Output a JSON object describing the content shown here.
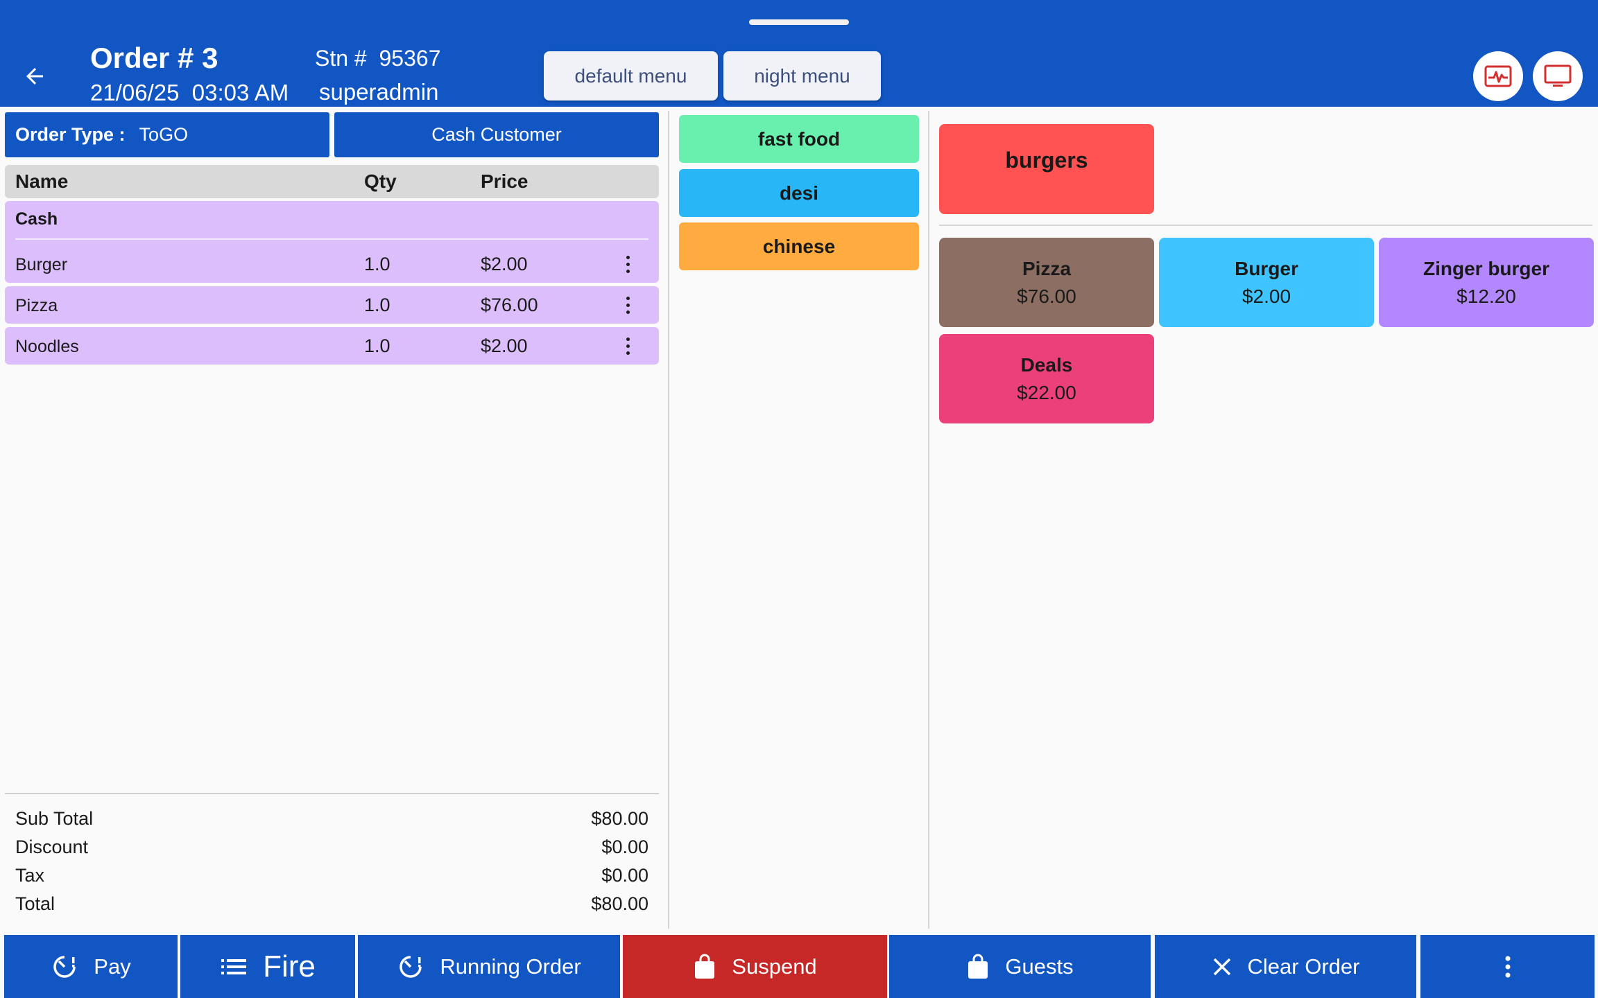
{
  "header": {
    "order_title": "Order # 3",
    "datetime": "21/06/25  03:03 AM",
    "station": "Stn #  95367",
    "user": "superadmin",
    "menus": [
      "default menu",
      "night menu"
    ],
    "icons": [
      "back-arrow-icon",
      "pulse-card-icon",
      "monitor-icon"
    ]
  },
  "order": {
    "type_label": "Order Type :",
    "type_value": "ToGO",
    "customer": "Cash Customer",
    "columns": [
      "Name",
      "Qty",
      "Price"
    ],
    "group": "Cash",
    "items": [
      {
        "name": "Burger",
        "qty": "1.0",
        "price": "$2.00"
      },
      {
        "name": "Pizza",
        "qty": "1.0",
        "price": "$76.00"
      },
      {
        "name": "Noodles",
        "qty": "1.0",
        "price": "$2.00"
      }
    ],
    "totals": [
      {
        "label": "Sub Total",
        "value": "$80.00"
      },
      {
        "label": "Discount",
        "value": "$0.00"
      },
      {
        "label": "Tax",
        "value": "$0.00"
      },
      {
        "label": "Total",
        "value": "$80.00"
      }
    ]
  },
  "categories": [
    {
      "label": "fast food",
      "color": "#69f0ae"
    },
    {
      "label": "desi",
      "color": "#29b6f6"
    },
    {
      "label": "chinese",
      "color": "#ffab40"
    }
  ],
  "subcategory": {
    "label": "burgers",
    "color": "#ff5252"
  },
  "products": [
    {
      "name": "Pizza",
      "price": "$76.00",
      "color": "#8d6e63"
    },
    {
      "name": "Burger",
      "price": "$2.00",
      "color": "#40c4ff"
    },
    {
      "name": "Zinger burger",
      "price": "$12.20",
      "color": "#b388ff"
    },
    {
      "name": "Deals",
      "price": "$22.00",
      "color": "#ec407a"
    }
  ],
  "bottom_bar": {
    "pay": "Pay",
    "fire": "Fire",
    "running_order": "Running Order",
    "suspend": "Suspend",
    "guests": "Guests",
    "clear_order": "Clear Order"
  },
  "colors": {
    "primary": "#1156c3",
    "suspend": "#c62828",
    "order_row": "#dcbefd",
    "header_icon": "#d32f2f"
  }
}
